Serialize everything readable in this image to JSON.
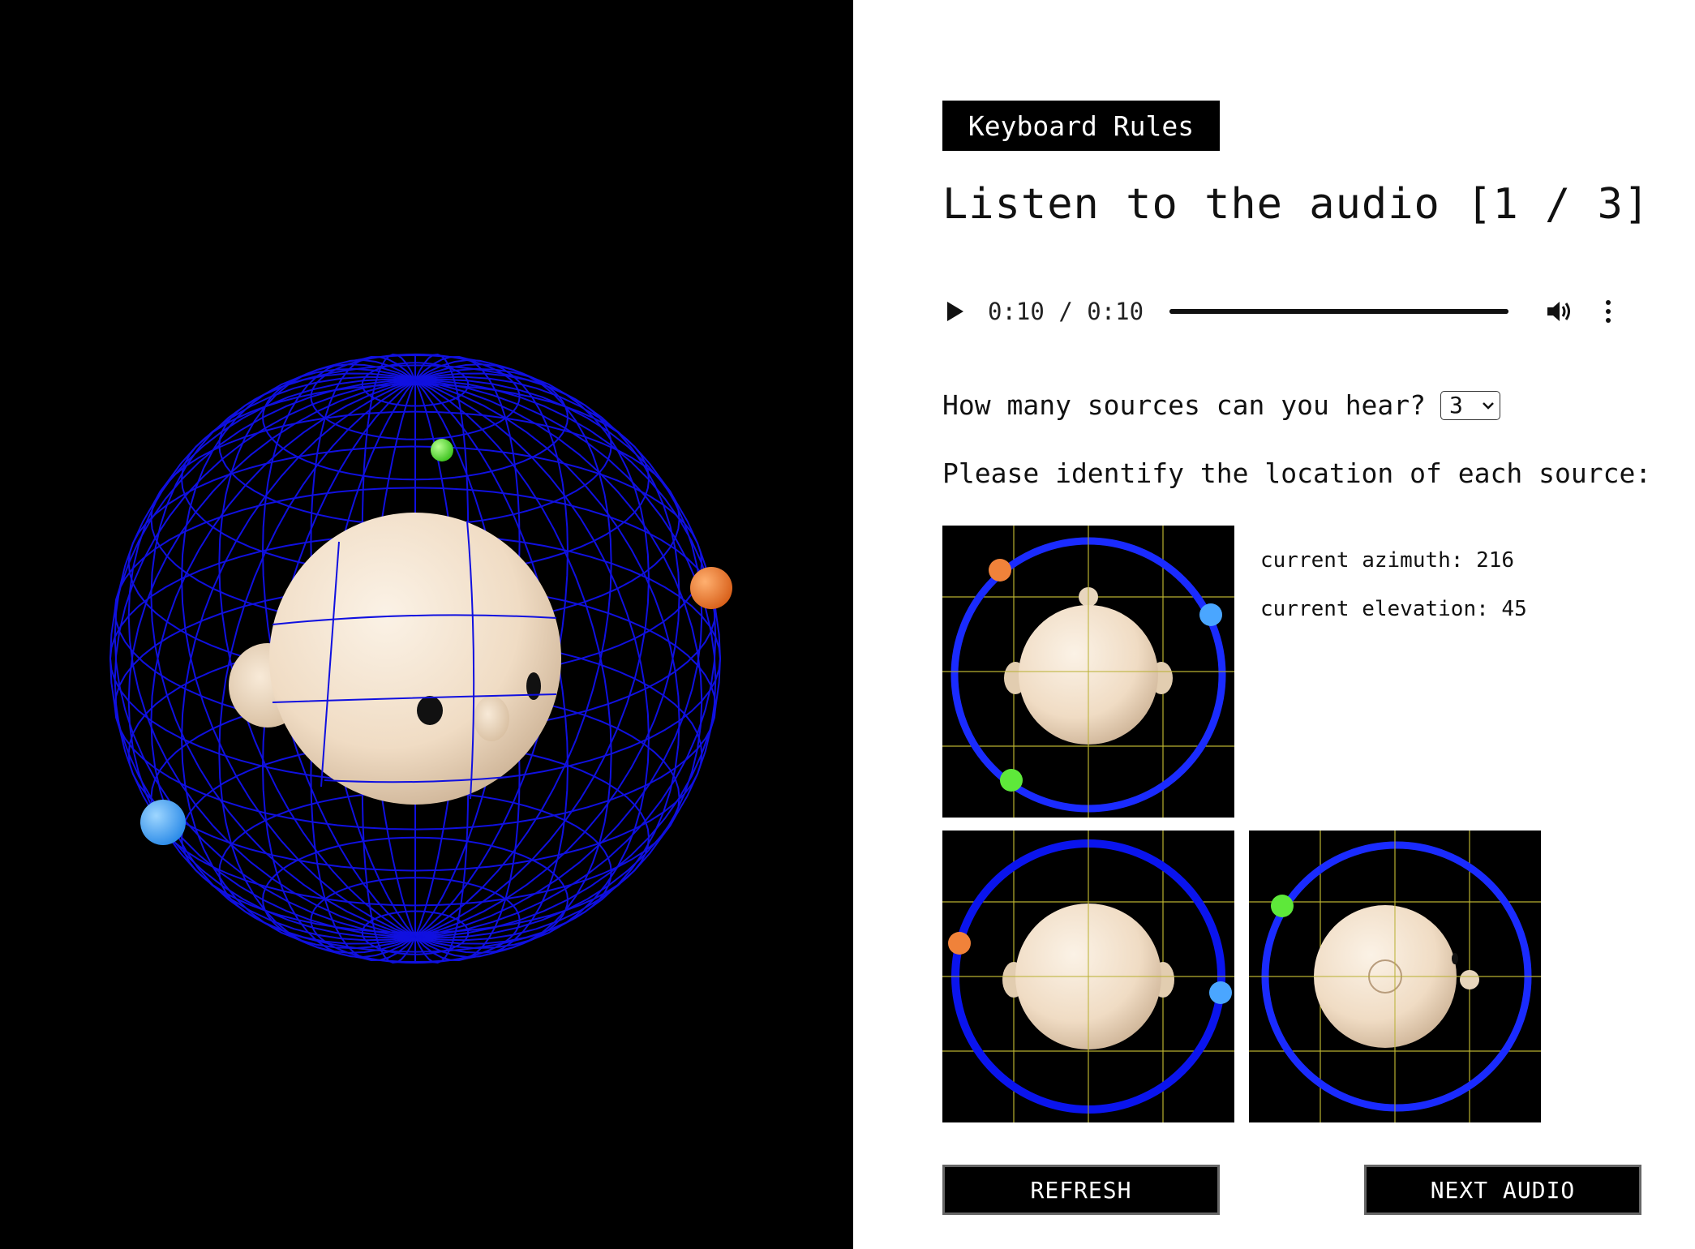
{
  "toolbar": {
    "keyboard_rules_label": "Keyboard Rules"
  },
  "page": {
    "title": "Listen to the audio [1 / 3]"
  },
  "audio": {
    "current_time": "0:10",
    "separator": "/",
    "duration": "0:10",
    "progress": 1.0
  },
  "sources_question": {
    "label": "How many sources can you hear?",
    "selected": "3"
  },
  "instruction": "Please identify the location of each source:",
  "readout": {
    "azimuth_label": "current azimuth: 216",
    "elevation_label": "current elevation: 45"
  },
  "actions": {
    "refresh_label": "REFRESH",
    "next_label": "NEXT AUDIO"
  },
  "colors": {
    "wireframe": "#1010e0",
    "ring": "#1a2bff",
    "source_orange": "#f0823a",
    "source_blue": "#4aa6ff",
    "source_green": "#5ee83a",
    "head": "#f2e1cc",
    "grid": "#b8b030"
  },
  "icons": [
    "play-icon",
    "volume-icon",
    "more-options-icon",
    "chevron-down-icon"
  ]
}
